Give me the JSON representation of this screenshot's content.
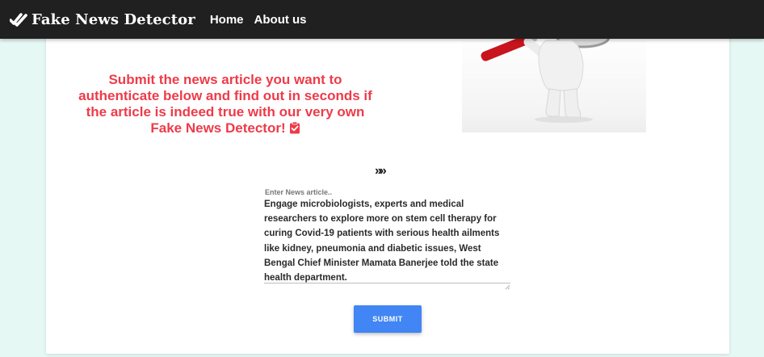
{
  "nav": {
    "brand": "Fake News Detector",
    "brand_icon": "double-check-icon",
    "links": [
      "Home",
      "About us"
    ]
  },
  "main": {
    "headline": "Submit the news article you want to authenticate below and find out in seconds if the article is indeed true with our very own Fake News Detector!",
    "headline_icon": "clipboard-check-icon",
    "arrows": "»»",
    "input_label": "Enter News article..",
    "article_text": "Engage microbiologists, experts and medical researchers to explore more on stem cell therapy for curing Covid-19 patients with serious health ailments like kidney, pneumonia and diabetic issues, West Bengal Chief Minister Mamata Banerjee told the state health department.\nWhile instructing the state Chief Secretary Rajiva Sinha (at the",
    "submit_label": "SUBMIT"
  },
  "colors": {
    "navbar": "#202020",
    "page_bg": "#e6f8f3",
    "headline": "#ee3b49",
    "button": "#4285f4"
  }
}
